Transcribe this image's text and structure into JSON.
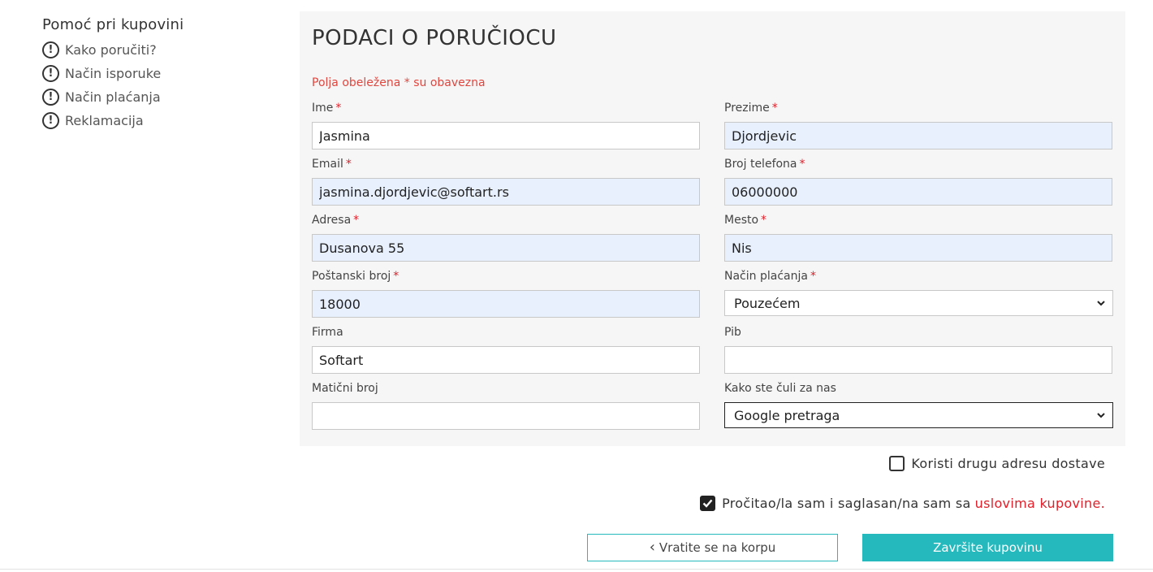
{
  "sidebar": {
    "title": "Pomoć pri kupovini",
    "icon_glyph": "!",
    "items": [
      {
        "label": "Kako poručiti?"
      },
      {
        "label": "Način isporuke"
      },
      {
        "label": "Način plaćanja"
      },
      {
        "label": "Reklamacija"
      }
    ]
  },
  "form": {
    "title": "PODACI O PORUČIOCU",
    "required_note": "Polja obeležena * su obavezna",
    "required_mark": "*",
    "ime": {
      "label": "Ime",
      "value": "Jasmina"
    },
    "prezime": {
      "label": "Prezime",
      "value": "Djordjevic"
    },
    "email": {
      "label": "Email",
      "value": "jasmina.djordjevic@softart.rs"
    },
    "telefon": {
      "label": "Broj telefona",
      "value": "06000000"
    },
    "adresa": {
      "label": "Adresa",
      "value": "Dusanova 55"
    },
    "mesto": {
      "label": "Mesto",
      "value": "Nis"
    },
    "postanski": {
      "label": "Poštanski broj",
      "value": "18000"
    },
    "placanje": {
      "label": "Način plaćanja",
      "selected": "Pouzećem"
    },
    "firma": {
      "label": "Firma",
      "value": "Softart"
    },
    "pib": {
      "label": "Pib",
      "value": ""
    },
    "maticni": {
      "label": "Matični broj",
      "value": ""
    },
    "izvor": {
      "label": "Kako ste čuli za nas",
      "selected": "Google pretraga"
    }
  },
  "options": {
    "other_address": {
      "label": "Koristi drugu adresu dostave",
      "checked": false
    },
    "terms": {
      "label": "Pročitao/la sam i saglasan/na sam sa",
      "link": "uslovima kupovine.",
      "checked": true
    }
  },
  "buttons": {
    "back_arrow": "‹",
    "back": "Vratite se na korpu",
    "finish": "Završite kupovinu"
  },
  "colors": {
    "accent": "#25b9bd",
    "required": "#e0202a",
    "autofill": "#e8f0fe"
  }
}
